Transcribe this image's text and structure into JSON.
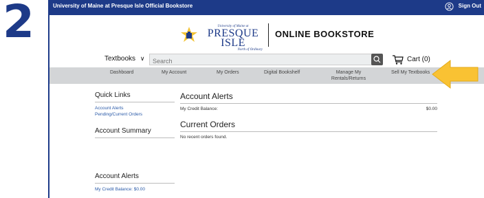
{
  "step_number": "2",
  "topbar": {
    "university_name": "University of Maine at Presque Isle Official Bookstore",
    "sign_out": "Sign Out"
  },
  "logo": {
    "small_line": "University of Maine at",
    "main": "PRESQUE ISLE",
    "tagline": "North of Ordinary"
  },
  "store_title": "ONLINE BOOKSTORE",
  "searchbar": {
    "textbooks_label": "Textbooks",
    "search_placeholder": "Search",
    "cart_label": "Cart (0)"
  },
  "nav": {
    "items": [
      {
        "label": "Dashboard"
      },
      {
        "label": "My Account"
      },
      {
        "label": "My Orders"
      },
      {
        "label": "Digital Bookshelf"
      },
      {
        "label": "Manage My Rentals/Returns"
      },
      {
        "label": "Sell My Textbooks"
      }
    ]
  },
  "sidebar": {
    "quick_links_title": "Quick Links",
    "quick_links": [
      "Account Alerts",
      "Pending/Current Orders"
    ],
    "account_summary_title": "Account Summary",
    "account_alerts_title": "Account Alerts",
    "credit_line": "My Credit Balance: $0.00"
  },
  "main": {
    "alerts_title": "Account Alerts",
    "credit_label": "My Credit Balance:",
    "credit_value": "$0.00",
    "orders_title": "Current Orders",
    "orders_empty": "No recent orders found."
  },
  "colors": {
    "brand_navy": "#1d3a88",
    "nav_gray": "#d3d5d7",
    "arrow_yellow": "#f9c233",
    "link_blue": "#2a5aa8"
  },
  "icons": [
    "user-icon",
    "seal-icon",
    "chevron-down-icon",
    "search-icon",
    "cart-icon",
    "arrow-icon"
  ]
}
